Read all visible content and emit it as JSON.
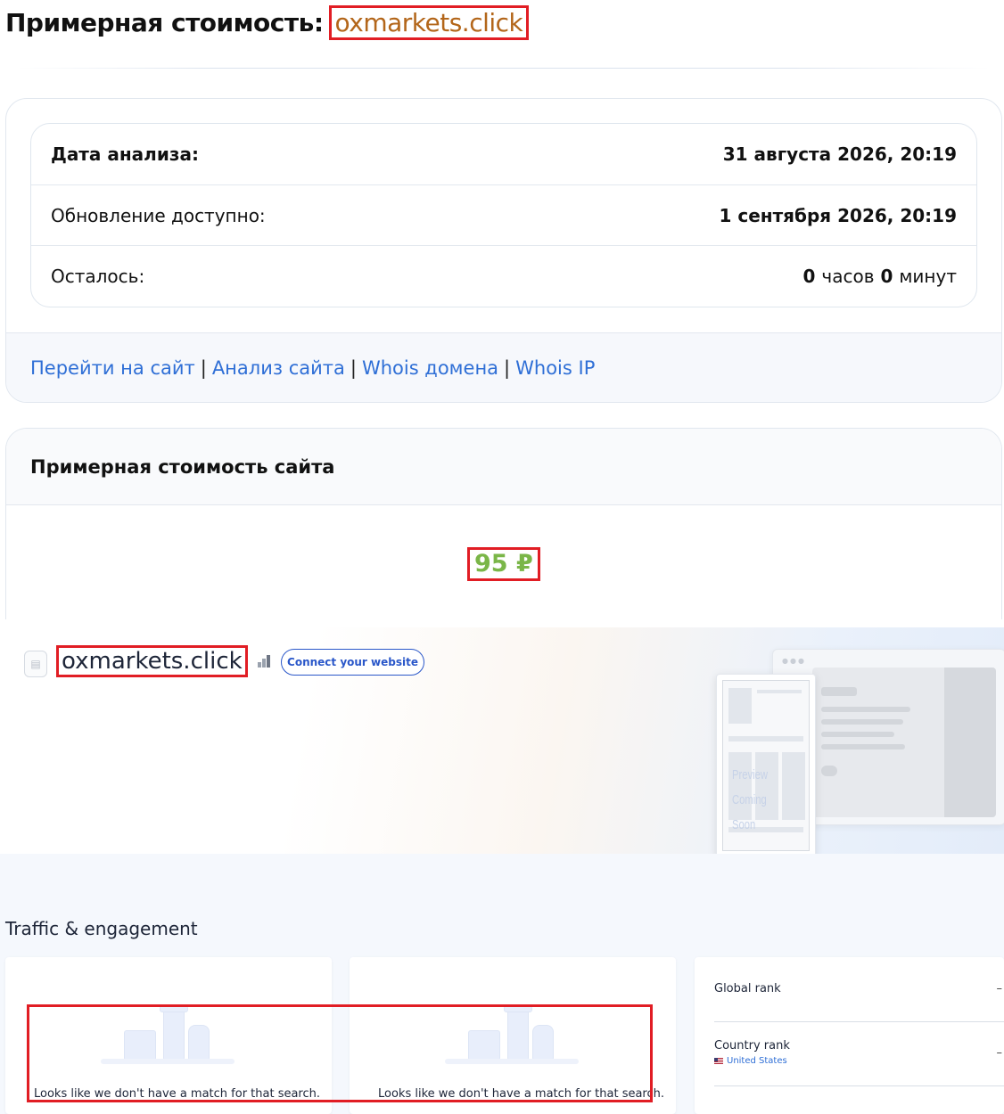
{
  "page": {
    "title_prefix": "Примерная стоимость:",
    "domain": "oxmarkets.click"
  },
  "analysis": {
    "rows": [
      {
        "label": "Дата анализа:",
        "value": "31 августа 2026, 20:19"
      },
      {
        "label": "Обновление доступно:",
        "value": "1 сентября 2026, 20:19"
      }
    ],
    "remaining": {
      "label": "Осталось:",
      "hours": "0",
      "hours_unit": "часов",
      "minutes": "0",
      "minutes_unit": "минут"
    }
  },
  "links": [
    {
      "label": "Перейти на сайт"
    },
    {
      "label": "Анализ сайта"
    },
    {
      "label": "Whois домена"
    },
    {
      "label": "Whois IP"
    }
  ],
  "links_separator": "|",
  "valuation": {
    "heading": "Примерная стоимость сайта",
    "price": "95 ₽"
  },
  "site_header": {
    "domain": "oxmarkets.click",
    "connect_button": "Connect your website",
    "preview_line1": "Preview",
    "preview_line2": "Coming Soon"
  },
  "traffic": {
    "title": "Traffic & engagement",
    "empty_message": "Looks like we don't have a match for that search.",
    "global_rank": {
      "label": "Global rank",
      "value": "–"
    },
    "country_rank": {
      "label": "Country rank",
      "value": "–",
      "country": "United States"
    }
  },
  "colors": {
    "link": "#2f6fd6",
    "price": "#7ab648",
    "highlight_border": "#e11d24",
    "domain_title": "#b3661a",
    "connect_button": "#2a57c9"
  }
}
